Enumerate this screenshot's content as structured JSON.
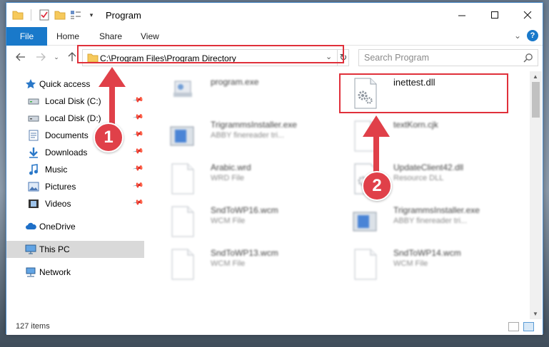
{
  "window": {
    "title": "Program"
  },
  "ribbon": {
    "file_tab": "File",
    "tabs": [
      "Home",
      "Share",
      "View"
    ],
    "help": "?"
  },
  "address": {
    "path": "C:\\Program Files\\Program Directory"
  },
  "search": {
    "placeholder": "Search Program"
  },
  "nav": {
    "quick_access": "Quick access",
    "items": [
      {
        "label": "Local Disk (C:)",
        "icon": "drive-icon"
      },
      {
        "label": "Local Disk (D:)",
        "icon": "drive-icon"
      },
      {
        "label": "Documents",
        "icon": "documents-icon"
      },
      {
        "label": "Downloads",
        "icon": "download-icon"
      },
      {
        "label": "Music",
        "icon": "music-icon"
      },
      {
        "label": "Pictures",
        "icon": "pictures-icon"
      },
      {
        "label": "Videos",
        "icon": "videos-icon"
      }
    ],
    "onedrive": "OneDrive",
    "this_pc": "This PC",
    "network": "Network"
  },
  "files": [
    {
      "name": "program.exe",
      "type": "",
      "icon": "exe-icon"
    },
    {
      "name": "inettest.dll",
      "type": "",
      "icon": "dll-icon"
    },
    {
      "name": "TrigrammsInstaller.exe",
      "type": "ABBY finereader tri...",
      "icon": "installer-icon"
    },
    {
      "name": "textKorn.cjk",
      "type": "",
      "icon": "file-icon"
    },
    {
      "name": "Arabic.wrd",
      "type": "WRD File",
      "icon": "file-icon"
    },
    {
      "name": "UpdateClient42.dll",
      "type": "Resource DLL",
      "icon": "dll-icon"
    },
    {
      "name": "SndToWP16.wcm",
      "type": "WCM File",
      "icon": "file-icon"
    },
    {
      "name": "TrigrammsInstaller.exe",
      "type": "ABBY finereader tri...",
      "icon": "installer-icon"
    },
    {
      "name": "SndToWP13.wcm",
      "type": "WCM File",
      "icon": "file-icon"
    },
    {
      "name": "SndToWP14.wcm",
      "type": "WCM File",
      "icon": "file-icon"
    }
  ],
  "status": {
    "items": "127 items"
  },
  "callouts": [
    "1",
    "2"
  ],
  "colors": {
    "accent": "#1979ca",
    "highlight": "#e0303a",
    "callout": "#e04049",
    "selected": "#d9d9d9"
  }
}
